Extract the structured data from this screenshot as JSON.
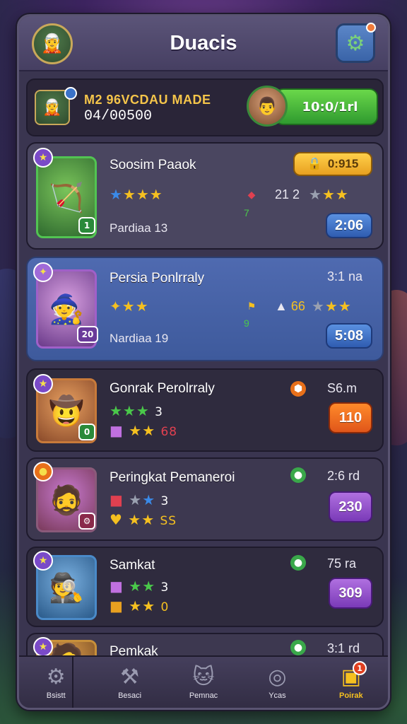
{
  "app": {
    "title": "Duacis"
  },
  "player": {
    "name": "M2 96VCDAU MADE",
    "score": "04/00500",
    "progress_label": "10:0/1rl"
  },
  "cards": [
    {
      "name": "Soosim Paaok",
      "sub": "Pardiaa 13",
      "meta": "21 2",
      "badge_label": "0:915",
      "button": "2:06",
      "side_digit": "7"
    },
    {
      "name": "Persia Ponlrraly",
      "sub": "Nardiaa 19",
      "meta": "3:1 na",
      "meta2": "66",
      "portrait_badge": "20",
      "button": "5:08",
      "side_digit": "9"
    },
    {
      "name": "Gonrak Perolrraly",
      "meta": "S6.m",
      "stat1": "3",
      "stat2": "68",
      "button": "110"
    },
    {
      "name": "Peringkat Pemaneroi",
      "meta": "2:6 rd",
      "stat1": "3",
      "stat2": "SS",
      "button": "230"
    },
    {
      "name": "Samkat",
      "meta": "75 ra",
      "stat1": "3",
      "stat2": "0",
      "button": "309"
    },
    {
      "name": "Pemkak",
      "meta": "3:1 rd"
    }
  ],
  "nav": {
    "items": [
      {
        "label": "Bsistt",
        "icon": "gear-icon"
      },
      {
        "label": "Besaci",
        "icon": "hammer-icon"
      },
      {
        "label": "Pemnac",
        "icon": "cat-icon"
      },
      {
        "label": "Ycas",
        "icon": "circle-icon"
      },
      {
        "label": "Poirak",
        "icon": "chest-icon",
        "badge": "1"
      }
    ]
  },
  "colors": {
    "accent": "#f5c020",
    "panel": "#3a3550",
    "blue_card": "#4f6ab0"
  }
}
